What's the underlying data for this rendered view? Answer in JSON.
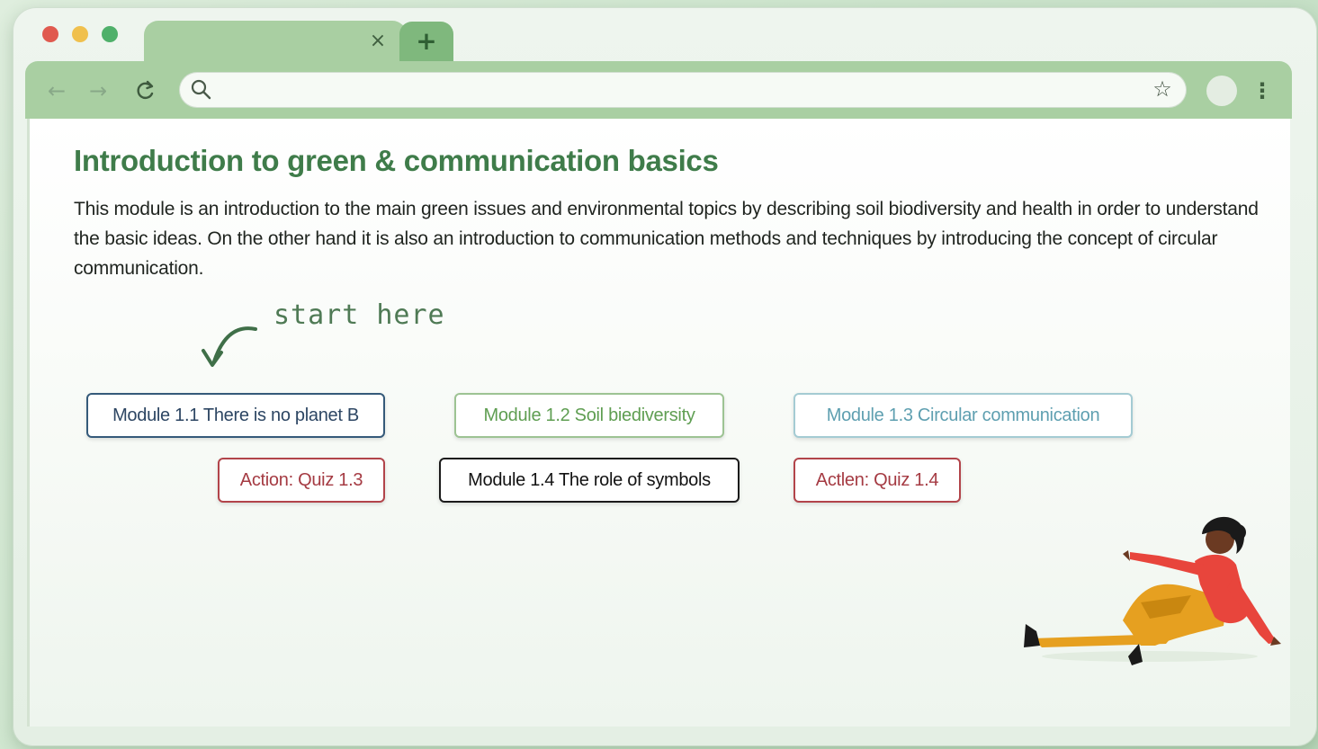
{
  "browser": {
    "tab": {
      "title": "",
      "close_glyph": "×"
    },
    "new_tab_glyph": "+",
    "toolbar": {
      "back_glyph": "←",
      "forward_glyph": "→",
      "reload_glyph": "C",
      "address_value": "",
      "bookmark_glyph": "☆",
      "menu_glyph": "⋮"
    },
    "colors": {
      "tab_bar": "#a9cfa2",
      "new_tab": "#7fb87d",
      "close_dot": "#e05a4f",
      "minimize_dot": "#f0c04d",
      "maximize_dot": "#4fb06a"
    }
  },
  "page": {
    "title": "Introduction to green & communication basics",
    "description": "This module is an introduction to the main green issues and environmental topics by describing soil biodiversity and health in order to understand the basic ideas. On the other hand it is also an introduction to communication methods and techniques by introducing the concept of circular communication.",
    "hint": "start here",
    "modules": [
      {
        "label": "Module 1.1 There is no planet B",
        "color": "#2d4663"
      },
      {
        "label": "Module 1.2 Soil biediversity",
        "color": "#5f9e52"
      },
      {
        "label": "Module 1.3 Circular communication",
        "color": "#5e9fb0"
      },
      {
        "label": "Action: Quiz 1.3",
        "color": "#a53b43"
      },
      {
        "label": "Module 1.4 The role of symbols",
        "color": "#121212"
      },
      {
        "label": "Actlen: Quiz 1.4",
        "color": "#a53b43"
      }
    ],
    "title_color": "#3f7c4a"
  }
}
